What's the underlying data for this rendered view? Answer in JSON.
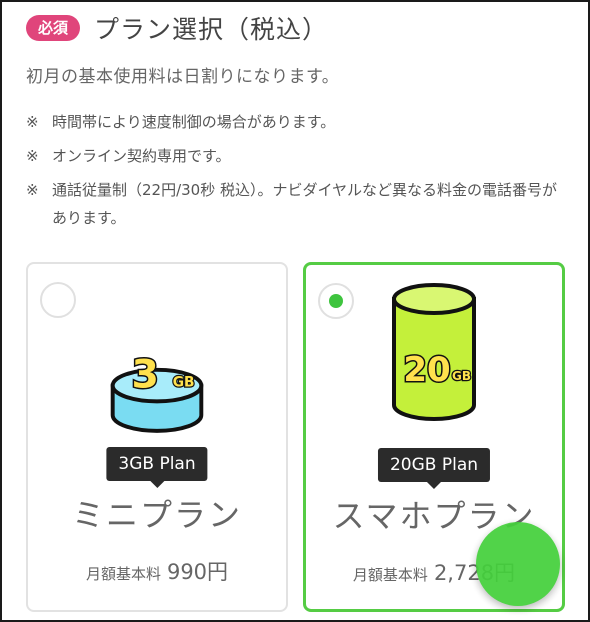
{
  "header": {
    "badge": "必須",
    "title": "プラン選択（税込）"
  },
  "intro": "初月の基本使用料は日割りになります。",
  "notes": [
    {
      "mark": "※",
      "text": "時間帯により速度制御の場合があります。"
    },
    {
      "mark": "※",
      "text": "オンライン契約専用です。"
    },
    {
      "mark": "※",
      "text": "通話従量制（22円/30秒 税込）。ナビダイヤルなど異なる料金の電話番号があります。"
    }
  ],
  "plans": [
    {
      "selected": false,
      "capacity": "3",
      "unit": "GB",
      "tooltip": "3GB Plan",
      "name": "ミニプラン",
      "price_label": "月額基本料",
      "price": "990円",
      "color": "#7adcf2"
    },
    {
      "selected": true,
      "capacity": "20",
      "unit": "GB",
      "tooltip": "20GB Plan",
      "name": "スマホプラン",
      "price_label": "月額基本料",
      "price": "2,728円",
      "color": "#c4f03a"
    }
  ],
  "colors": {
    "badge": "#e0457b",
    "selected_border": "#55cc44",
    "fab": "#44d03c",
    "tooltip_bg": "#2b2b2b"
  }
}
